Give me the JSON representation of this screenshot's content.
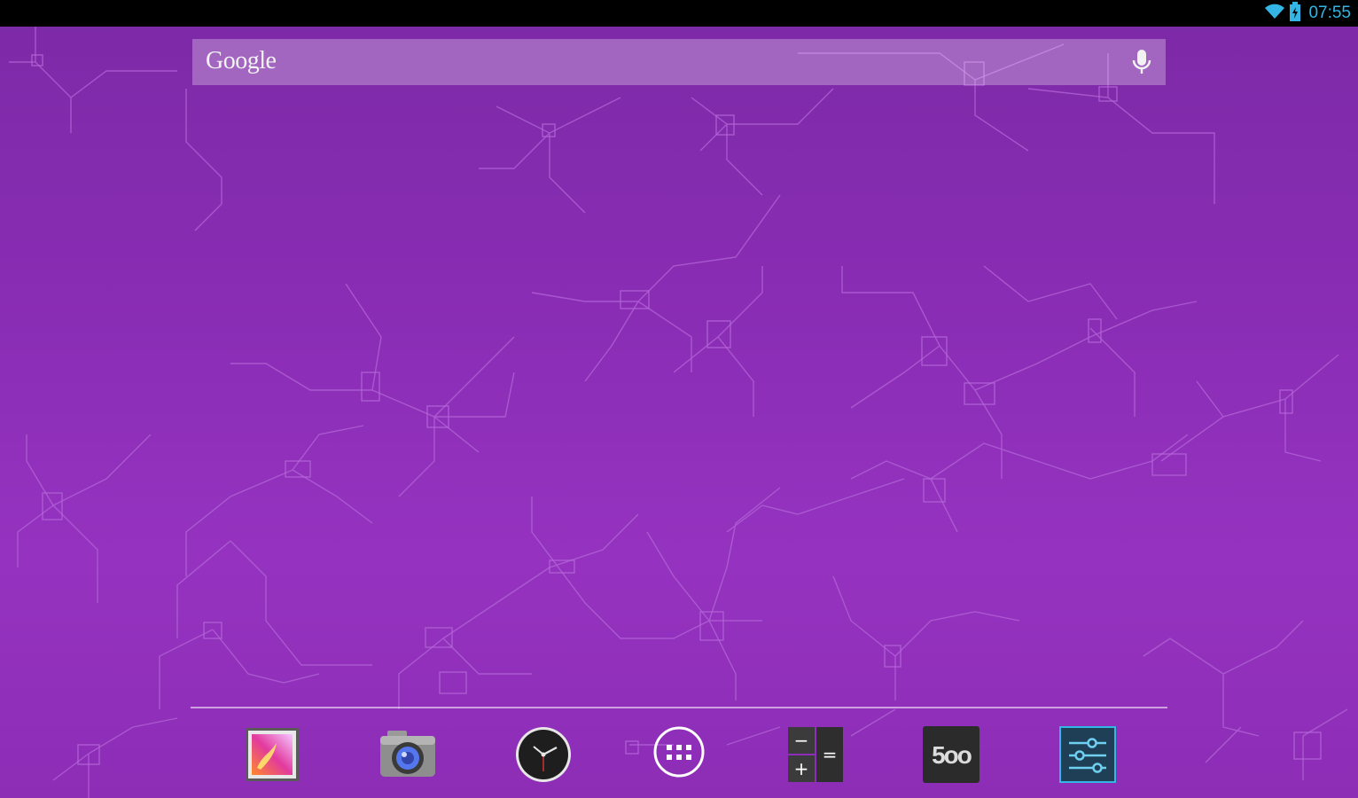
{
  "status_bar": {
    "time": "07:55",
    "wifi_icon": "wifi-icon",
    "battery_icon": "battery-charging-icon",
    "accent": "#33b5e5"
  },
  "search": {
    "logo": "Google",
    "mic_icon": "mic-icon"
  },
  "dock": {
    "items": [
      {
        "icon": "gallery-icon"
      },
      {
        "icon": "camera-icon"
      },
      {
        "icon": "clock-icon"
      },
      {
        "icon": "app-drawer-icon"
      },
      {
        "icon": "calculator-icon",
        "glyphs": [
          "−",
          "=",
          "+"
        ]
      },
      {
        "icon": "500px-icon",
        "label": "5oo"
      },
      {
        "icon": "settings-icon"
      }
    ]
  },
  "colors": {
    "wallpaper": "#8a2db5",
    "circuit_lines": "#b56ad6"
  }
}
